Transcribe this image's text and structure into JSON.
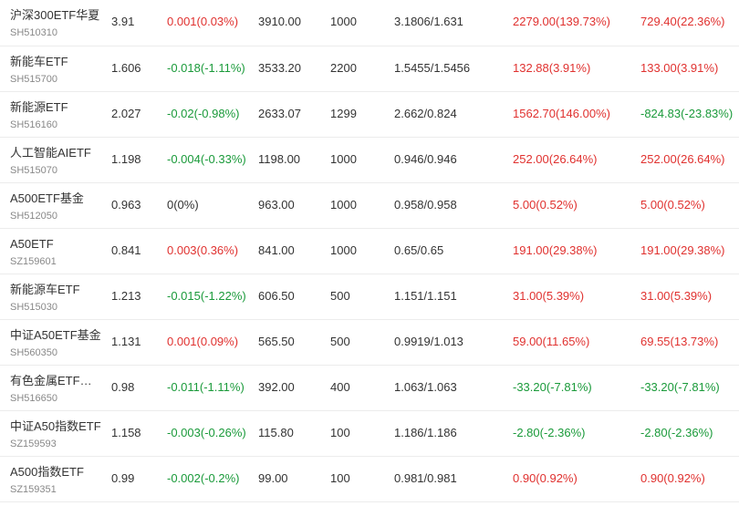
{
  "colors": {
    "up": "#e0312f",
    "down": "#1a9a3a",
    "neutral": "#333333"
  },
  "rows": [
    {
      "name": "沪深300ETF华夏",
      "code": "SH510310",
      "price": "3.91",
      "change": "0.001(0.03%)",
      "change_dir": "up",
      "value": "3910.00",
      "qty": "1000",
      "cost": "3.1806/1.631",
      "pl1": "2279.00(139.73%)",
      "pl1_dir": "up",
      "pl2": "729.40(22.36%)",
      "pl2_dir": "up"
    },
    {
      "name": "新能车ETF",
      "code": "SH515700",
      "price": "1.606",
      "change": "-0.018(-1.11%)",
      "change_dir": "down",
      "value": "3533.20",
      "qty": "2200",
      "cost": "1.5455/1.5456",
      "pl1": "132.88(3.91%)",
      "pl1_dir": "up",
      "pl2": "133.00(3.91%)",
      "pl2_dir": "up"
    },
    {
      "name": "新能源ETF",
      "code": "SH516160",
      "price": "2.027",
      "change": "-0.02(-0.98%)",
      "change_dir": "down",
      "value": "2633.07",
      "qty": "1299",
      "cost": "2.662/0.824",
      "pl1": "1562.70(146.00%)",
      "pl1_dir": "up",
      "pl2": "-824.83(-23.83%)",
      "pl2_dir": "down"
    },
    {
      "name": "人工智能AIETF",
      "code": "SH515070",
      "price": "1.198",
      "change": "-0.004(-0.33%)",
      "change_dir": "down",
      "value": "1198.00",
      "qty": "1000",
      "cost": "0.946/0.946",
      "pl1": "252.00(26.64%)",
      "pl1_dir": "up",
      "pl2": "252.00(26.64%)",
      "pl2_dir": "up"
    },
    {
      "name": "A500ETF基金",
      "code": "SH512050",
      "price": "0.963",
      "change": "0(0%)",
      "change_dir": "flat",
      "value": "963.00",
      "qty": "1000",
      "cost": "0.958/0.958",
      "pl1": "5.00(0.52%)",
      "pl1_dir": "up",
      "pl2": "5.00(0.52%)",
      "pl2_dir": "up"
    },
    {
      "name": "A50ETF",
      "code": "SZ159601",
      "price": "0.841",
      "change": "0.003(0.36%)",
      "change_dir": "up",
      "value": "841.00",
      "qty": "1000",
      "cost": "0.65/0.65",
      "pl1": "191.00(29.38%)",
      "pl1_dir": "up",
      "pl2": "191.00(29.38%)",
      "pl2_dir": "up"
    },
    {
      "name": "新能源车ETF",
      "code": "SH515030",
      "price": "1.213",
      "change": "-0.015(-1.22%)",
      "change_dir": "down",
      "value": "606.50",
      "qty": "500",
      "cost": "1.151/1.151",
      "pl1": "31.00(5.39%)",
      "pl1_dir": "up",
      "pl2": "31.00(5.39%)",
      "pl2_dir": "up"
    },
    {
      "name": "中证A50ETF基金",
      "code": "SH560350",
      "price": "1.131",
      "change": "0.001(0.09%)",
      "change_dir": "up",
      "value": "565.50",
      "qty": "500",
      "cost": "0.9919/1.013",
      "pl1": "59.00(11.65%)",
      "pl1_dir": "up",
      "pl2": "69.55(13.73%)",
      "pl2_dir": "up"
    },
    {
      "name": "有色金属ETF基金",
      "code": "SH516650",
      "price": "0.98",
      "change": "-0.011(-1.11%)",
      "change_dir": "down",
      "value": "392.00",
      "qty": "400",
      "cost": "1.063/1.063",
      "pl1": "-33.20(-7.81%)",
      "pl1_dir": "down",
      "pl2": "-33.20(-7.81%)",
      "pl2_dir": "down"
    },
    {
      "name": "中证A50指数ETF",
      "code": "SZ159593",
      "price": "1.158",
      "change": "-0.003(-0.26%)",
      "change_dir": "down",
      "value": "115.80",
      "qty": "100",
      "cost": "1.186/1.186",
      "pl1": "-2.80(-2.36%)",
      "pl1_dir": "down",
      "pl2": "-2.80(-2.36%)",
      "pl2_dir": "down"
    },
    {
      "name": "A500指数ETF",
      "code": "SZ159351",
      "price": "0.99",
      "change": "-0.002(-0.2%)",
      "change_dir": "down",
      "value": "99.00",
      "qty": "100",
      "cost": "0.981/0.981",
      "pl1": "0.90(0.92%)",
      "pl1_dir": "up",
      "pl2": "0.90(0.92%)",
      "pl2_dir": "up"
    }
  ]
}
